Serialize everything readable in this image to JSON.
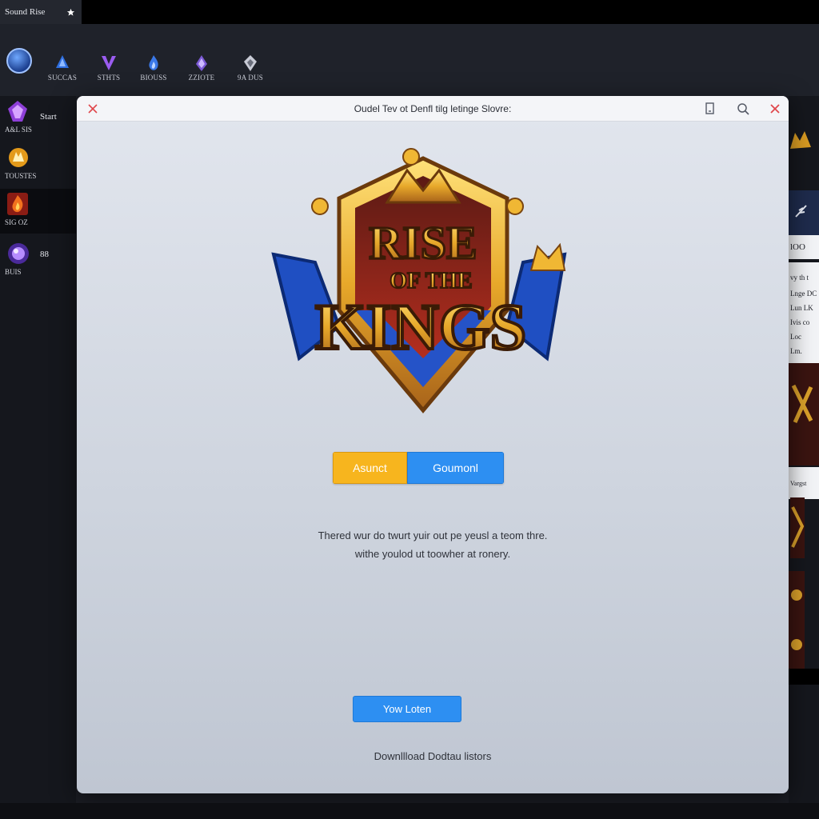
{
  "launcher": {
    "title": "Sound Rise"
  },
  "categories": [
    {
      "label": "SUCCAS",
      "icon": "blue-crystal-icon"
    },
    {
      "label": "STHTS",
      "icon": "purple-v-icon"
    },
    {
      "label": "BIOUSS",
      "icon": "blue-flame-icon"
    },
    {
      "label": "ZZIOTE",
      "icon": "violet-crystal-icon"
    },
    {
      "label": "9A DUS",
      "icon": "silver-crest-icon"
    }
  ],
  "sidebar": {
    "items": [
      {
        "label": "A&L SIS",
        "extra": "Start",
        "icon": "purple-gem-icon"
      },
      {
        "label": "TOUSTES",
        "extra": "",
        "icon": "gold-emblem-icon"
      },
      {
        "label": "SIG OZ",
        "extra": "",
        "icon": "red-flame-icon"
      },
      {
        "label": "BUIS",
        "extra": "88",
        "icon": "purple-orb-icon"
      }
    ]
  },
  "right_panel": {
    "lines": [
      "lOO",
      "vy th t",
      "Lnge DC",
      "Lun LK",
      "Ivis co",
      "Loc",
      "Lm.",
      "Vargst"
    ]
  },
  "modal": {
    "title": "Oudel Tev ot Denfl tilg letinge Slovre:",
    "logo": {
      "line1": "RISE",
      "line2": "OF THE",
      "line3": "KINGS"
    },
    "segment_left": "Asunct",
    "segment_right": "Goumonl",
    "desc_line1": "Thered wur do twurt yuir out pe yeusl a teom thre.",
    "desc_line2": "withe youlod ut toowher at ronery.",
    "primary_button": "Yow Loten",
    "footer_link": "Downllload Dodtau listors"
  },
  "colors": {
    "accent_yellow": "#f7b51e",
    "accent_blue": "#2d8ff2",
    "close_red": "#e0474c"
  }
}
